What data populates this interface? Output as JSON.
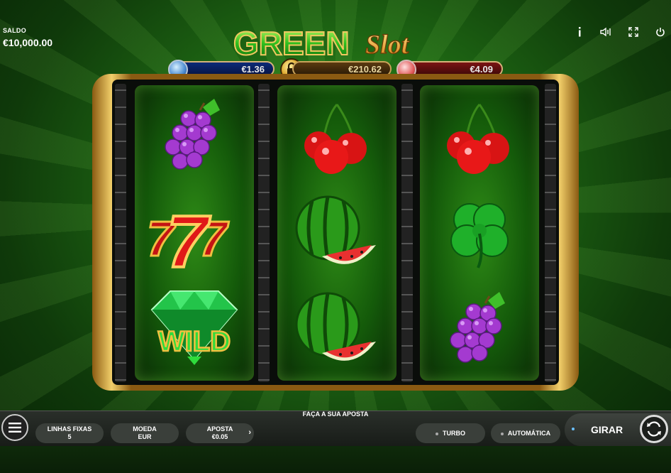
{
  "balance": {
    "label": "SALDO",
    "value": "€10,000.00"
  },
  "top_icons": [
    "info-icon",
    "sound-icon",
    "fullscreen-icon",
    "power-icon"
  ],
  "logo": {
    "word1": "GREEN",
    "word2": "Slot"
  },
  "jackpots": [
    {
      "value": "€1.36",
      "color": "#0c2a78"
    },
    {
      "value": "€210.62",
      "color": "#5a3a10"
    },
    {
      "value": "€4.09",
      "color": "#7a1414"
    }
  ],
  "reels": [
    [
      "grapes",
      "seven",
      "wild"
    ],
    [
      "cherries",
      "watermelon",
      "watermelon"
    ],
    [
      "cherries",
      "clover",
      "grapes"
    ]
  ],
  "wild_label": "WILD",
  "bottom": {
    "title": "FAÇA A SUA APOSTA",
    "lines_label": "LINHAS FIXAS",
    "lines_value": "5",
    "coin_label": "MOEDA",
    "coin_value": "EUR",
    "bet_label": "APOSTA",
    "bet_value": "€0.05",
    "turbo": "TURBO",
    "auto": "AUTOMÁTICA",
    "spin": "GIRAR"
  }
}
